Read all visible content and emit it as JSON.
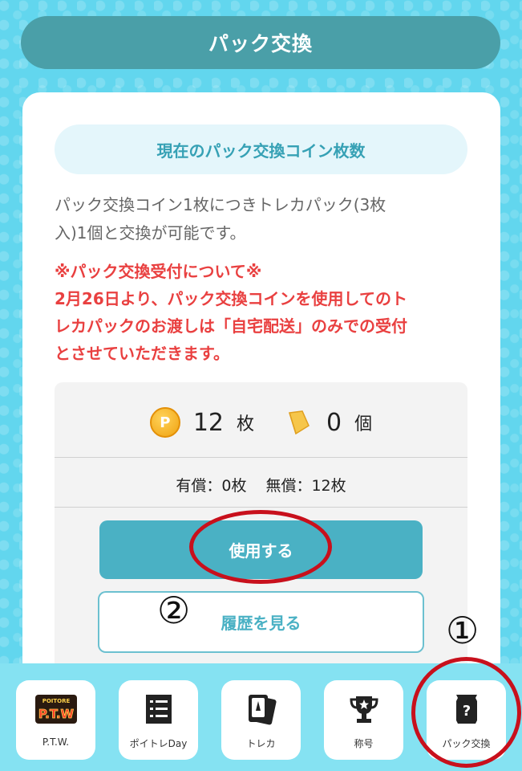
{
  "header": {
    "title": "パック交換"
  },
  "card": {
    "coin_heading": "現在のパック交換コイン枚数",
    "description_lines": [
      "パック交換コイン1枚につきトレカパック(3枚",
      "入)1個と交換が可能です。"
    ],
    "notice_lines": [
      "※パック交換受付について※",
      "2月26日より、パック交換コインを使用してのト",
      "レカパックのお渡しは「自宅配送」のみでの受付",
      "とさせていただきます。"
    ],
    "coin_icon_letter": "P",
    "coin_count": "12",
    "coin_unit": "枚",
    "pack_count": "0",
    "pack_unit": "個",
    "paid": "有償：0枚",
    "free": "無償：12枚",
    "use_button": "使用する",
    "history_button": "履歴を見る"
  },
  "annotations": {
    "first": "①",
    "second": "②"
  },
  "nav": {
    "items": [
      {
        "label": "P.T.W.",
        "icon": "ptw-logo-icon",
        "logo_text_top": "POITORE",
        "logo_text_main": "P.T.W"
      },
      {
        "label": "ポイトレDay",
        "icon": "list-icon"
      },
      {
        "label": "トレカ",
        "icon": "cards-icon"
      },
      {
        "label": "称号",
        "icon": "trophy-icon"
      },
      {
        "label": "パック交換",
        "icon": "pack-icon"
      }
    ]
  },
  "colors": {
    "accent": "#4ab1c4",
    "header": "#4a9fa8",
    "notice": "#e94040",
    "annotation_circle": "#c8101c"
  }
}
